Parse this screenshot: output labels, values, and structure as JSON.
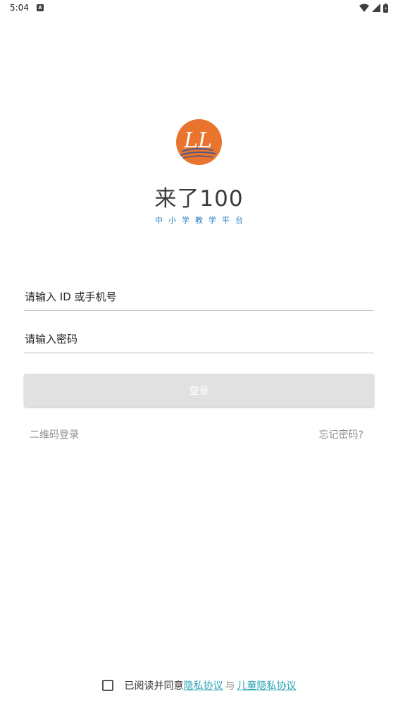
{
  "status_bar": {
    "time": "5:04",
    "notification_icon": "A",
    "icons": [
      "wifi-icon",
      "signal-icon",
      "battery-icon"
    ]
  },
  "app": {
    "logo_text": "LL",
    "title": "来了100",
    "subtitle": "中小学教学平台"
  },
  "form": {
    "id_placeholder": "请输入 ID 或手机号",
    "password_placeholder": "请输入密码",
    "login_label": "登录"
  },
  "links": {
    "qr_login": "二维码登录",
    "forgot_password": "忘记密码?"
  },
  "agreement": {
    "prefix": "已阅读并同意",
    "privacy_link": "隐私协议",
    "joiner": "与",
    "child_privacy_link": "儿童隐私协议"
  },
  "colors": {
    "logo_orange": "#e8742d",
    "subtitle_blue": "#2b7fc3",
    "link_teal": "#2aa3b4",
    "button_disabled": "#e1e1e1"
  }
}
